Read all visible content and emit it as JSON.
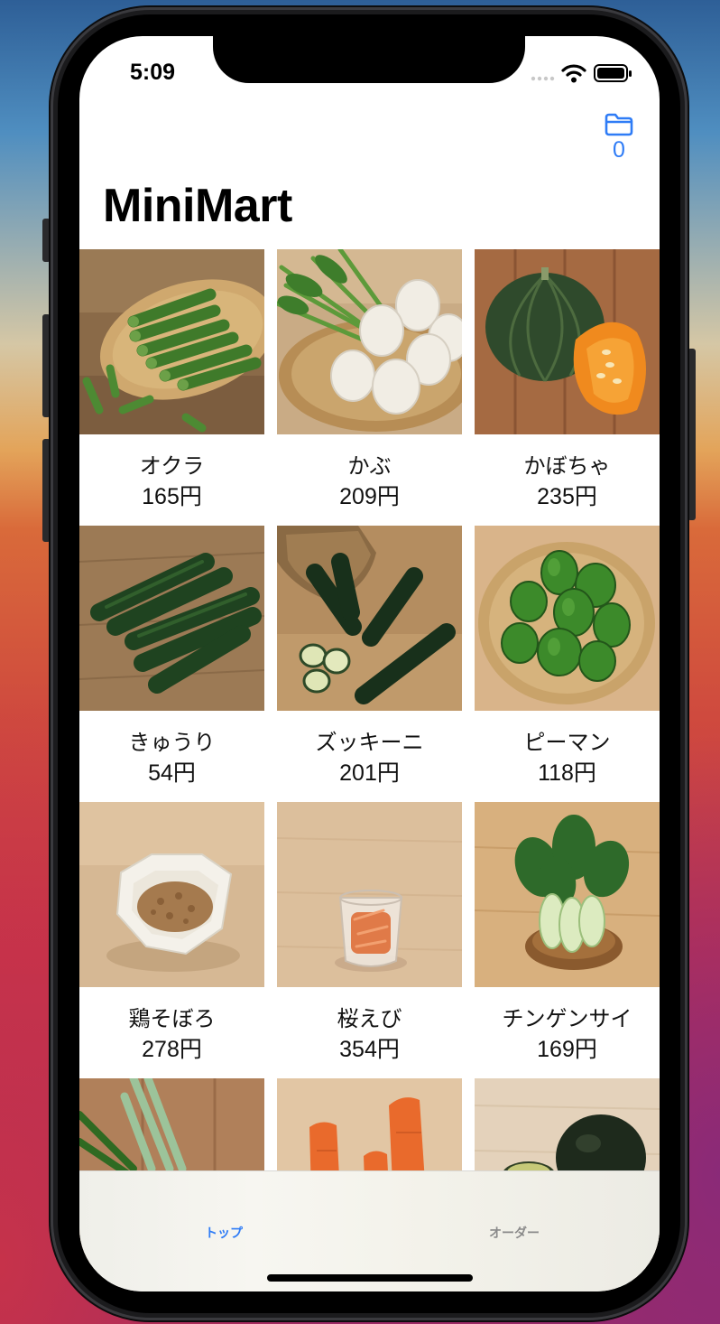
{
  "status_bar": {
    "time": "5:09",
    "icons": [
      "signal-dots-icon",
      "wifi-icon",
      "battery-icon"
    ]
  },
  "nav": {
    "title": "MiniMart",
    "cart_icon": "folder-icon",
    "cart_count": "0",
    "accent_color": "#2f7cf6"
  },
  "products": [
    {
      "name": "オクラ",
      "price": "165円",
      "image": "okra-photo"
    },
    {
      "name": "かぶ",
      "price": "209円",
      "image": "turnip-photo"
    },
    {
      "name": "かぼちゃ",
      "price": "235円",
      "image": "kabocha-photo"
    },
    {
      "name": "きゅうり",
      "price": "54円",
      "image": "cucumber-photo"
    },
    {
      "name": "ズッキーニ",
      "price": "201円",
      "image": "zucchini-photo"
    },
    {
      "name": "ピーマン",
      "price": "118円",
      "image": "green-pepper-photo"
    },
    {
      "name": "鶏そぼろ",
      "price": "278円",
      "image": "chicken-soboro-photo"
    },
    {
      "name": "桜えび",
      "price": "354円",
      "image": "sakura-shrimp-photo"
    },
    {
      "name": "チンゲンサイ",
      "price": "169円",
      "image": "bok-choy-photo"
    },
    {
      "name": "",
      "price": "",
      "image": "green-onion-photo"
    },
    {
      "name": "",
      "price": "",
      "image": "carrot-photo"
    },
    {
      "name": "",
      "price": "",
      "image": "avocado-photo"
    }
  ],
  "tabbar": {
    "tabs": [
      {
        "label": "トップ",
        "selected": true
      },
      {
        "label": "オーダー",
        "selected": false
      }
    ]
  }
}
